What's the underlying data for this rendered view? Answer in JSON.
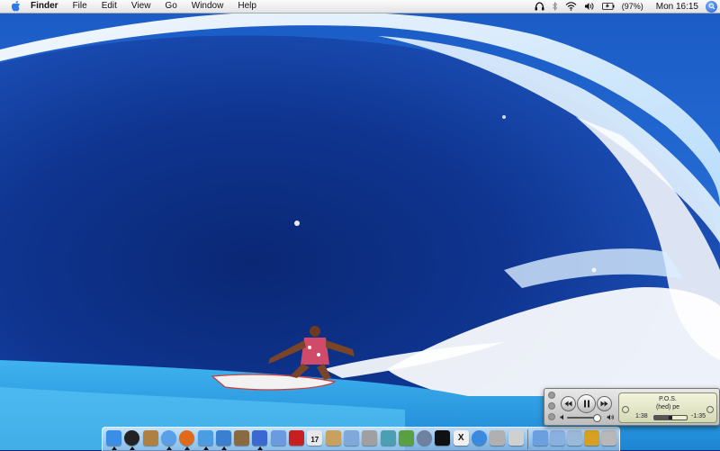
{
  "menubar": {
    "app_name": "Finder",
    "menus": [
      "File",
      "Edit",
      "View",
      "Go",
      "Window",
      "Help"
    ],
    "status": {
      "battery_text": "(97%)",
      "clock": "Mon 16:15"
    },
    "icons": [
      "apple-logo-icon",
      "headphones-icon",
      "bluetooth-icon",
      "wifi-icon",
      "volume-icon",
      "battery-icon",
      "spotlight-icon"
    ]
  },
  "itunes_player": {
    "song": "P.O.S.",
    "artist": "(hed) pe",
    "elapsed": "1:38",
    "remaining": "-1:35",
    "progress_fraction": 0.5,
    "volume_fraction": 0.85,
    "controls": [
      "previous-track",
      "pause",
      "next-track"
    ]
  },
  "dock": {
    "apps": [
      {
        "name": "finder",
        "color": "#3a8ee6"
      },
      {
        "name": "dashboard",
        "color": "#222222"
      },
      {
        "name": "photo-app",
        "color": "#b08040"
      },
      {
        "name": "safari",
        "color": "#5aa0e8"
      },
      {
        "name": "firefox",
        "color": "#e06a1a"
      },
      {
        "name": "ichat",
        "color": "#4a9de0"
      },
      {
        "name": "itunes",
        "color": "#3b7fd0"
      },
      {
        "name": "iphoto",
        "color": "#8a6a40"
      },
      {
        "name": "imovie",
        "color": "#3a6ad0"
      },
      {
        "name": "idvd",
        "color": "#6a9ae0"
      },
      {
        "name": "red-book-app",
        "color": "#c82020"
      },
      {
        "name": "ical",
        "color": "#e8e8e8"
      },
      {
        "name": "address-book",
        "color": "#c8a060"
      },
      {
        "name": "preview",
        "color": "#80a8d8"
      },
      {
        "name": "automator",
        "color": "#a0a0a0"
      },
      {
        "name": "ilife-app",
        "color": "#4aa0b0"
      },
      {
        "name": "bittorrent",
        "color": "#5aa040"
      },
      {
        "name": "system-preferences",
        "color": "#7080a0"
      },
      {
        "name": "terminal",
        "color": "#111111"
      },
      {
        "name": "x11",
        "color": "#f0f0f0"
      },
      {
        "name": "network-utility",
        "color": "#3a8ae0"
      },
      {
        "name": "calculator",
        "color": "#b0b0b0"
      },
      {
        "name": "about-mac",
        "color": "#d0d0d0"
      }
    ],
    "stacks": [
      {
        "name": "applications-folder",
        "color": "#6aa0e0"
      },
      {
        "name": "documents-folder",
        "color": "#8ab0e0"
      },
      {
        "name": "utilities-folder",
        "color": "#9ab8d8"
      },
      {
        "name": "lock-app",
        "color": "#d8a020"
      },
      {
        "name": "trash",
        "color": "#b8b8b8"
      }
    ],
    "x11_glyph": "X",
    "ical_day": "17"
  }
}
